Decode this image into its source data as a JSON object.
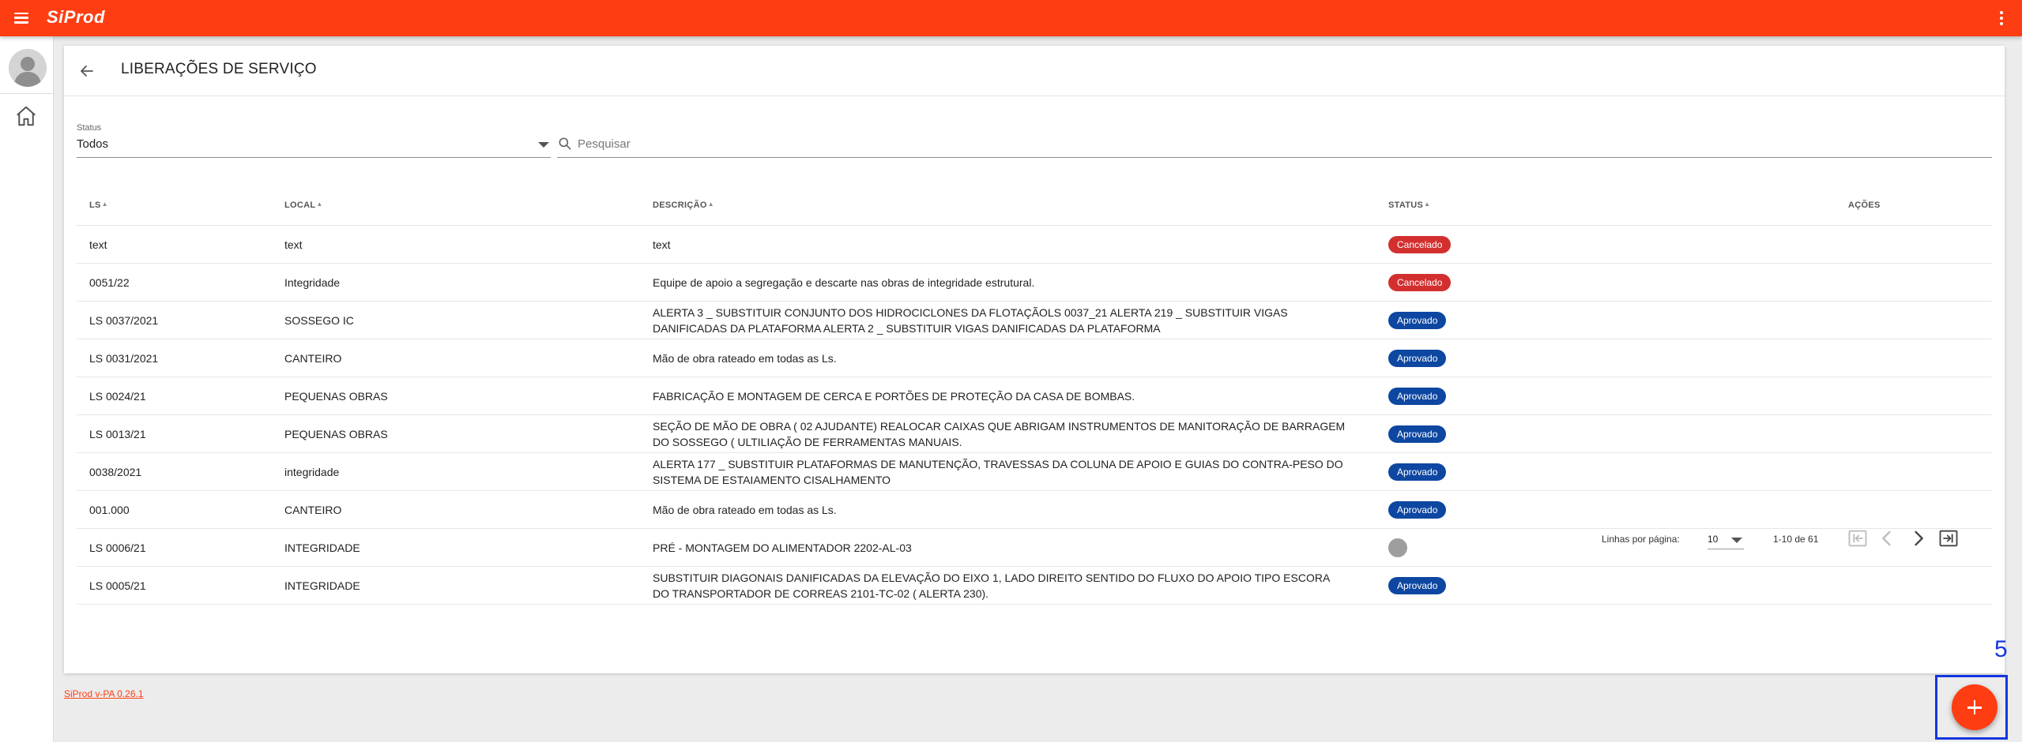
{
  "app": {
    "logo": "SiProd"
  },
  "header": {
    "title": "LIBERAÇÕES DE SERVIÇO"
  },
  "filters": {
    "status_label": "Status",
    "status_value": "Todos",
    "search_placeholder": "Pesquisar"
  },
  "table": {
    "columns": {
      "ls": "LS",
      "local": "LOCAL",
      "descricao": "DESCRIÇÃO",
      "status": "STATUS",
      "acoes": "AÇÕES"
    },
    "rows": [
      {
        "ls": "text",
        "local": "text",
        "descricao": "text",
        "status": "Cancelado"
      },
      {
        "ls": "0051/22",
        "local": "Integridade",
        "descricao": "Equipe de apoio a segregação e descarte nas obras de integridade estrutural.",
        "status": "Cancelado"
      },
      {
        "ls": "LS 0037/2021",
        "local": "SOSSEGO IC",
        "descricao": " ALERTA 3 _ SUBSTITUIR CONJUNTO DOS HIDROCICLONES DA FLOTAÇÃOLS 0037_21 ALERTA 219 _ SUBSTITUIR VIGAS DANIFICADAS DA PLATAFORMA ALERTA 2 _ SUBSTITUIR VIGAS DANIFICADAS DA PLATAFORMA",
        "status": "Aprovado"
      },
      {
        "ls": "LS 0031/2021",
        "local": "CANTEIRO",
        "descricao": "Mão de obra rateado em todas as Ls.",
        "status": "Aprovado"
      },
      {
        "ls": "LS 0024/21",
        "local": "PEQUENAS OBRAS",
        "descricao": "FABRICAÇÃO E MONTAGEM DE CERCA E PORTÕES DE PROTEÇÃO DA CASA DE BOMBAS.",
        "status": "Aprovado"
      },
      {
        "ls": "LS 0013/21",
        "local": "PEQUENAS OBRAS",
        "descricao": "SEÇÃO DE MÃO DE OBRA ( 02 AJUDANTE) REALOCAR CAIXAS QUE ABRIGAM INSTRUMENTOS DE MANITORAÇÃO DE BARRAGEM DO SOSSEGO ( ULTILIAÇÃO DE FERRAMENTAS MANUAIS.",
        "status": "Aprovado"
      },
      {
        "ls": "0038/2021",
        "local": "integridade",
        "descricao": "ALERTA 177 _ SUBSTITUIR PLATAFORMAS DE MANUTENÇÃO, TRAVESSAS DA COLUNA DE APOIO E GUIAS DO CONTRA-PESO DO SISTEMA DE ESTAIAMENTO CISALHAMENTO",
        "status": "Aprovado"
      },
      {
        "ls": "001.000",
        "local": "CANTEIRO",
        "descricao": "Mão de obra rateado em todas as Ls.",
        "status": "Aprovado"
      },
      {
        "ls": "LS 0006/21",
        "local": "INTEGRIDADE",
        "descricao": "PRÉ - MONTAGEM DO ALIMENTADOR 2202-AL-03",
        "status": ""
      },
      {
        "ls": "LS 0005/21",
        "local": "INTEGRIDADE",
        "descricao": "SUBSTITUIR DIAGONAIS DANIFICADAS DA ELEVAÇÃO DO EIXO 1, LADO DIREITO SENTIDO DO FLUXO DO APOIO TIPO ESCORA DO TRANSPORTADOR DE CORREAS 2101-TC-02 ( ALERTA 230).",
        "status": "Aprovado"
      }
    ]
  },
  "status_colors": {
    "Cancelado": "#d32f2f",
    "Aprovado": "#0d47a1",
    "empty": "#9e9e9e"
  },
  "pagination": {
    "rows_label": "Linhas por página:",
    "rows_value": "10",
    "range": "1-10 de 61"
  },
  "footer": {
    "version": "SiProd v-PA 0.26.1"
  },
  "annotation": {
    "label": "5"
  },
  "icons": [
    "menu-icon",
    "more-vert-icon",
    "avatar-icon",
    "home-icon",
    "back-arrow-icon",
    "search-icon",
    "first-page-icon",
    "prev-page-icon",
    "next-page-icon",
    "last-page-icon",
    "add-icon"
  ]
}
